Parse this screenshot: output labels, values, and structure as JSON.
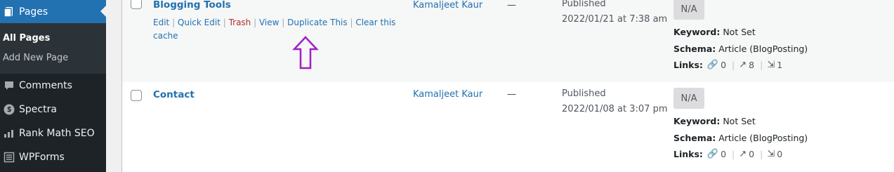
{
  "sidebar": {
    "items": [
      {
        "label": "Pages",
        "icon": "pages-icon"
      },
      {
        "label": "Comments",
        "icon": "comments-icon"
      },
      {
        "label": "Spectra",
        "icon": "spectra-icon"
      },
      {
        "label": "Rank Math SEO",
        "icon": "chart-icon"
      },
      {
        "label": "WPForms",
        "icon": "forms-icon"
      }
    ],
    "submenu": [
      {
        "label": "All Pages"
      },
      {
        "label": "Add New Page"
      }
    ]
  },
  "rows": [
    {
      "title": "Blogging Tools",
      "actions": {
        "edit": "Edit",
        "quick_edit": "Quick Edit",
        "trash": "Trash",
        "view": "View",
        "duplicate": "Duplicate This",
        "clear_cache": "Clear this cache"
      },
      "author": "Kamaljeet Kaur",
      "comments": "—",
      "status": "Published",
      "date": "2022/01/21 at 7:38 am",
      "seo_score": "N/A",
      "keyword_label": "Keyword:",
      "keyword": "Not Set",
      "schema_label": "Schema:",
      "schema": "Article (BlogPosting)",
      "links_label": "Links:",
      "links_internal": "0",
      "links_external": "8",
      "links_incoming": "1"
    },
    {
      "title": "Contact",
      "author": "Kamaljeet Kaur",
      "comments": "—",
      "status": "Published",
      "date": "2022/01/08 at 3:07 pm",
      "seo_score": "N/A",
      "keyword_label": "Keyword:",
      "keyword": "Not Set",
      "schema_label": "Schema:",
      "schema": "Article (BlogPosting)",
      "links_label": "Links:",
      "links_internal": "0",
      "links_external": "0",
      "links_incoming": "0"
    }
  ],
  "colors": {
    "sidebar_bg": "#1d2327",
    "accent": "#2271b1",
    "trash": "#b32d2e",
    "annotation_arrow": "#a020c8"
  }
}
